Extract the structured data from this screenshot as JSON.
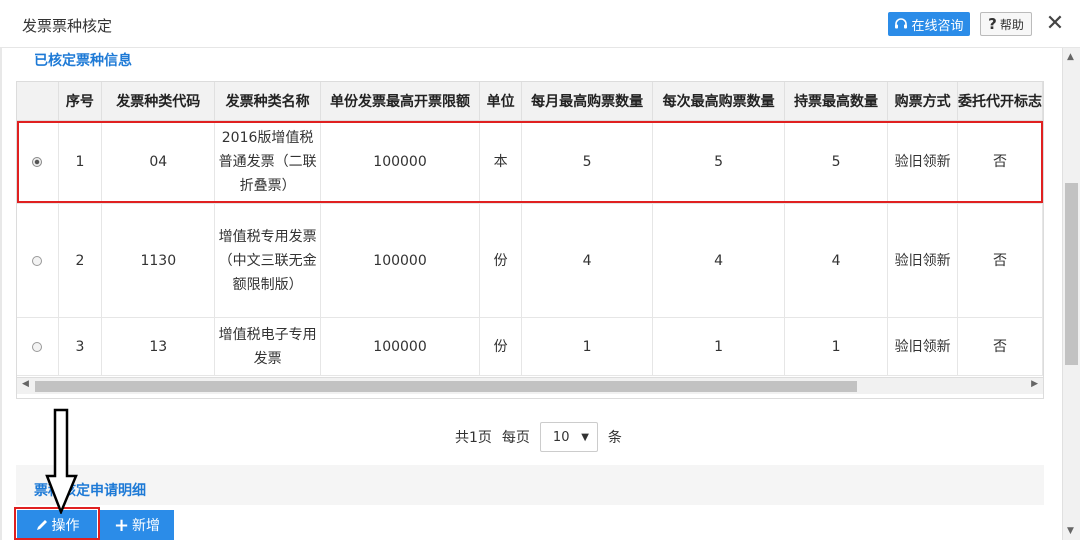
{
  "window": {
    "title": "发票票种核定"
  },
  "header": {
    "consult_label": "在线咨询",
    "help_label": "帮助",
    "help_mark": "?",
    "close_glyph": "✕",
    "consult_icon": "headset-icon"
  },
  "section1": {
    "title": "已核定票种信息"
  },
  "table": {
    "headers": [
      "",
      "序号",
      "发票种类代码",
      "发票种类名称",
      "单份发票最高开票限额",
      "单位",
      "每月最高购票数量",
      "每次最高购票数量",
      "持票最高数量",
      "购票方式",
      "委托代开标志"
    ],
    "rows": [
      {
        "selected": true,
        "seq": "1",
        "code": "04",
        "name": "2016版增值税普通发票（二联折叠票）",
        "limit": "100000",
        "unit": "本",
        "monthly": "5",
        "per_time": "5",
        "hold": "5",
        "method": "验旧领新",
        "delegate": "否"
      },
      {
        "selected": false,
        "seq": "2",
        "code": "1130",
        "name": "增值税专用发票（中文三联无金额限制版）",
        "limit": "100000",
        "unit": "份",
        "monthly": "4",
        "per_time": "4",
        "hold": "4",
        "method": "验旧领新",
        "delegate": "否"
      },
      {
        "selected": false,
        "seq": "3",
        "code": "13",
        "name": "增值税电子专用发票",
        "limit": "100000",
        "unit": "份",
        "monthly": "1",
        "per_time": "1",
        "hold": "1",
        "method": "验旧领新",
        "delegate": "否"
      }
    ]
  },
  "pager": {
    "total": "共1页",
    "per_page_label": "每页",
    "per_page_value": "10",
    "unit": "条"
  },
  "section2": {
    "title": "票种核定申请明细"
  },
  "actions": {
    "operate_label": "操作",
    "add_label": "新增",
    "plus": "+"
  },
  "colors": {
    "accent": "#2b8ce8",
    "title_blue": "#1e7ad6",
    "highlight": "#e02020"
  }
}
